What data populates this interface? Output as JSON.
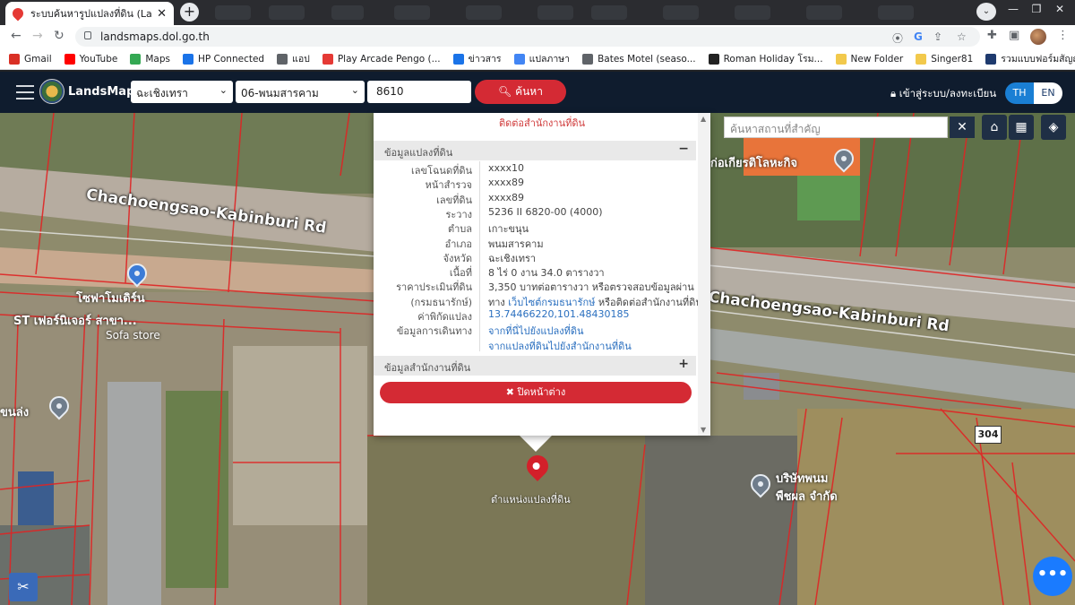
{
  "browser": {
    "tab_title": "ระบบค้นหารูปแปลงที่ดิน (LandsMa...",
    "url": "landsmaps.dol.go.th",
    "bookmarks": [
      "Gmail",
      "YouTube",
      "Maps",
      "HP Connected",
      "แอป",
      "Play Arcade Pengo (...",
      "ข่าวสาร",
      "แปลภาษา",
      "Bates Motel (seaso...",
      "Roman Holiday โรม...",
      "New Folder",
      "Singer81",
      "รวมแบบฟอร์มสัญญา..."
    ],
    "bookmark_colors": [
      "#d93025",
      "#ff0000",
      "#34a853",
      "#1a73e8",
      "#5f6368",
      "#e53935",
      "#1a73e8",
      "#4285f4",
      "#5f6368",
      "#222222",
      "#f2c94c",
      "#f2c94c",
      "#1e3a6e"
    ]
  },
  "app": {
    "brand": "LandsMaps",
    "province": "ฉะเชิงเทรา",
    "district": "06-พนมสารคาม",
    "parcel_number": "8610",
    "search_label": "ค้นหา",
    "login_label": "เข้าสู่ระบบ/ลงทะเบียน",
    "lang_th": "TH",
    "lang_en": "EN",
    "accent_color": "#d42a34"
  },
  "map": {
    "place_search_placeholder": "ค้นหาสถานที่สำคัญ",
    "road_left": "Chachoengsao-Kabinburi Rd",
    "road_right": "Chachoengsao-Kabinburi Rd",
    "road_shield": "304",
    "label_store_1": "โซฟาโมเดิร์น",
    "label_store_2": "ST เฟอร์นิเจอร์ สาขา...",
    "label_store_3": "Sofa store",
    "label_left_edge": "ขนล่ง",
    "label_top_right": "ก่อเกียรติโลหะกิจ",
    "label_company_1": "บริษัทพนม",
    "label_company_2": "พืชผล จำกัด",
    "parcel_label": "ตำแหน่งแปลงที่ดิน"
  },
  "popup": {
    "top_link": "ติดต่อสำนักงานที่ดิน",
    "section_parcel": "ข้อมูลแปลงที่ดิน",
    "section_office": "ข้อมูลสำนักงานที่ดิน",
    "close_label": "ปิดหน้าต่าง",
    "rows": [
      {
        "k": "เลขโฉนดที่ดิน",
        "v": "xxxx10"
      },
      {
        "k": "หน้าสำรวจ",
        "v": "xxxx89"
      },
      {
        "k": "เลขที่ดิน",
        "v": "xxxx89"
      },
      {
        "k": "ระวาง",
        "v": "5236 II 6820-00 (4000)"
      },
      {
        "k": "ตำบล",
        "v": "เกาะขนุน"
      },
      {
        "k": "อำเภอ",
        "v": "พนมสารคาม"
      },
      {
        "k": "จังหวัด",
        "v": "ฉะเชิงเทรา"
      },
      {
        "k": "เนื้อที่",
        "v": "8 ไร่ 0 งาน 34.0 ตารางวา"
      },
      {
        "k": "ราคาประเมินที่ดิน",
        "v": "3,350 บาทต่อตารางวา หรือตรวจสอบข้อมูลผ่าน"
      },
      {
        "k": "(กรมธนารักษ์)",
        "v_pre": "ทาง ",
        "v_link": "เว็บไซต์กรมธนารักษ์",
        "v_post": " หรือติดต่อสำนักงานที่ดิน"
      },
      {
        "k": "ค่าพิกัดแปลง",
        "v": "13.74466220,101.48430185"
      },
      {
        "k": "ข้อมูลการเดินทาง",
        "v": "จากที่นี่ไปยังแปลงที่ดิน"
      },
      {
        "k": "",
        "v": "จากแปลงที่ดินไปยังสำนักงานที่ดิน"
      }
    ]
  }
}
